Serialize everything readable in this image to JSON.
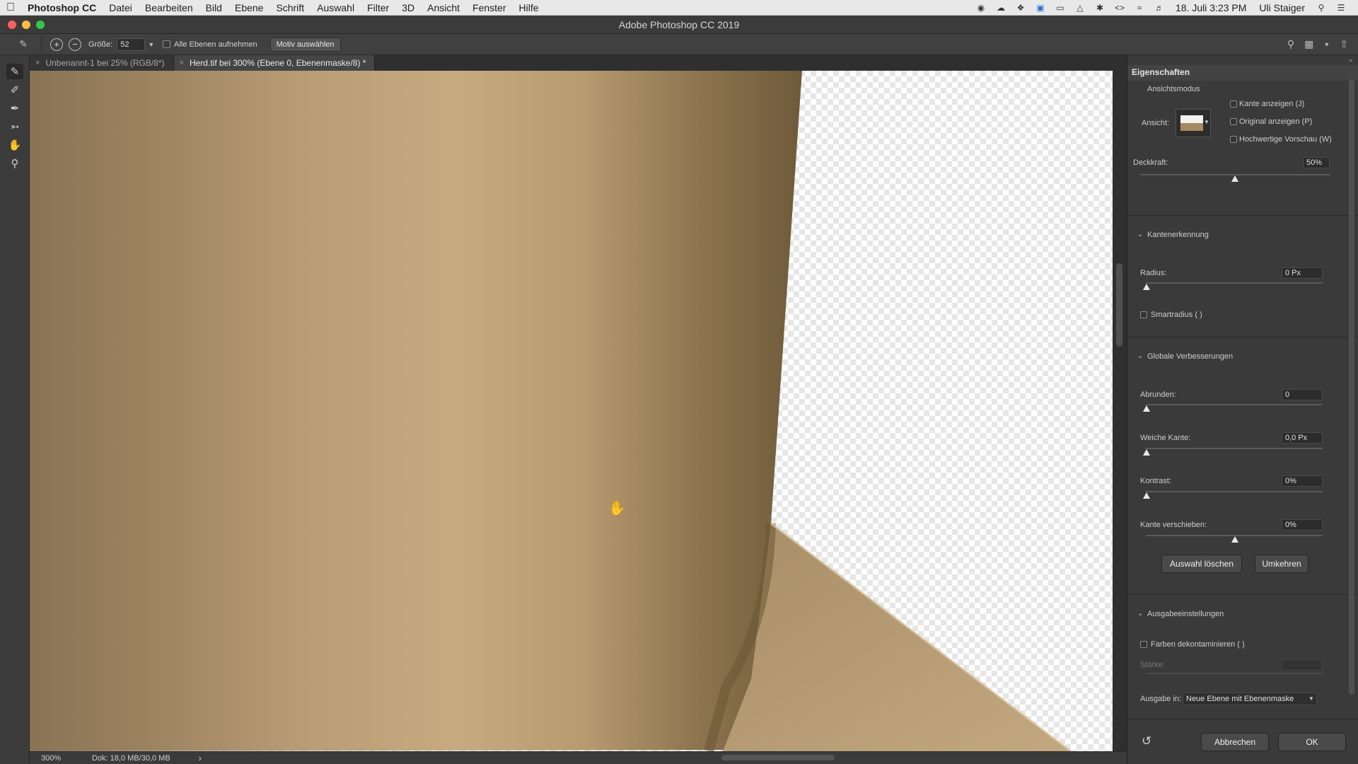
{
  "menubar": {
    "app": "Photoshop CC",
    "items": [
      "Datei",
      "Bearbeiten",
      "Bild",
      "Ebene",
      "Schrift",
      "Auswahl",
      "Filter",
      "3D",
      "Ansicht",
      "Fenster",
      "Hilfe"
    ],
    "datetime": "18. Juli  3:23 PM",
    "user": "Uli Staiger"
  },
  "window": {
    "title": "Adobe Photoshop CC 2019"
  },
  "options": {
    "size_label": "Größe:",
    "size_value": "52",
    "all_layers_label": "Alle Ebenen aufnehmen",
    "select_subject": "Motiv auswählen"
  },
  "tabs": [
    {
      "label": "Unbenannt-1 bei 25% (RGB/8*)",
      "close": "×"
    },
    {
      "label": "Herd.tif bei 300% (Ebene 0, Ebenenmaske/8) *",
      "close": "×"
    }
  ],
  "status": {
    "zoom": "300%",
    "doc": "Dok: 18,0 MB/30,0 MB",
    "arrow": "›"
  },
  "panel": {
    "title": "Eigenschaften",
    "view_mode": {
      "heading": "Ansichtsmodus",
      "view_label": "Ansicht:",
      "show_edge": "Kante anzeigen (J)",
      "show_original": "Original anzeigen (P)",
      "hq_preview": "Hochwertige Vorschau (W)",
      "opacity_label": "Deckkraft:",
      "opacity_value": "50%",
      "opacity_fraction": 0.5
    },
    "edge_detection": {
      "heading": "Kantenerkennung",
      "radius_label": "Radius:",
      "radius_value": "0 Px",
      "smart_radius": "Smartradius (  )"
    },
    "global": {
      "heading": "Globale Verbesserungen",
      "smooth_label": "Abrunden:",
      "smooth_value": "0",
      "feather_label": "Weiche Kante:",
      "feather_value": "0,0 Px",
      "contrast_label": "Kontrast:",
      "contrast_value": "0%",
      "shift_label": "Kante verschieben:",
      "shift_value": "0%",
      "clear_btn": "Auswahl löschen",
      "invert_btn": "Umkehren"
    },
    "output": {
      "heading": "Ausgabeeinstellungen",
      "decontaminate": "Farben dekontaminieren (  )",
      "amount_label": "Stärke:",
      "output_label": "Ausgabe in:",
      "output_value": "Neue Ebene mit Ebenenmaske"
    },
    "cancel": "Abbrechen",
    "ok": "OK"
  },
  "colors": {
    "accent": "#3b3b3b",
    "panel": "#3a3a3a",
    "metal": "#bfa37a"
  }
}
